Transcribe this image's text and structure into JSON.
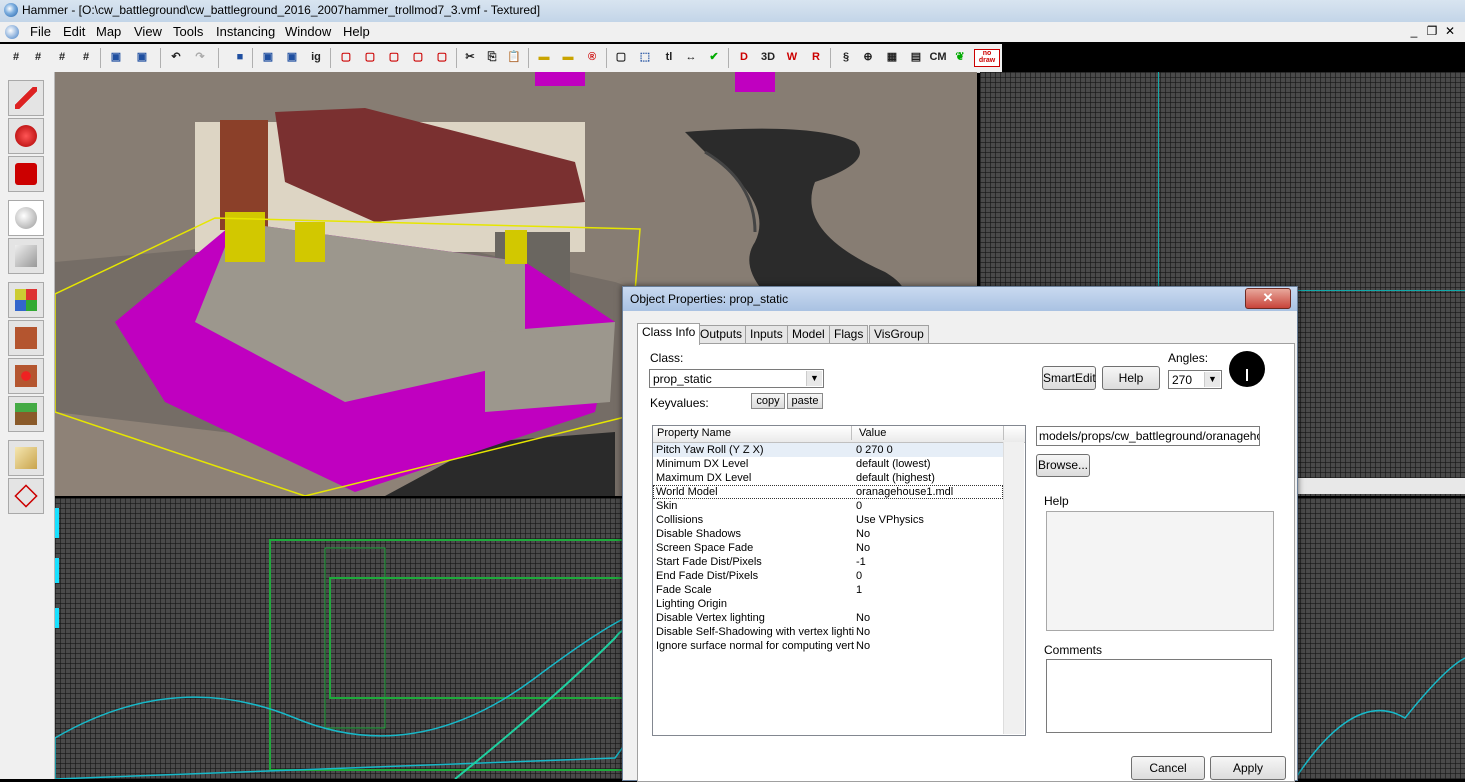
{
  "window": {
    "title": "Hammer - [O:\\cw_battleground\\cw_battleground_2016_2007hammer_trollmod7_3.vmf - Textured]"
  },
  "menu": [
    "File",
    "Edit",
    "Map",
    "View",
    "Tools",
    "Instancing",
    "Window",
    "Help"
  ],
  "toolbar": {
    "label_tl": "tl",
    "label_cm": "CM",
    "label_nodraw": "no draw"
  },
  "dialog": {
    "title": "Object Properties: prop_static",
    "close": "✕",
    "tabs": [
      "Class Info",
      "Outputs",
      "Inputs",
      "Model",
      "Flags",
      "VisGroup"
    ],
    "class_label": "Class:",
    "class_value": "prop_static",
    "keyvalues_label": "Keyvalues:",
    "copy": "copy",
    "paste": "paste",
    "smartedit": "SmartEdit",
    "help_btn": "Help",
    "angles_label": "Angles:",
    "angles_value": "270",
    "columns": [
      "Property Name",
      "Value"
    ],
    "rows": [
      {
        "k": "Pitch Yaw Roll (Y Z X)",
        "v": "0 270 0"
      },
      {
        "k": "Minimum DX Level",
        "v": "default (lowest)"
      },
      {
        "k": "Maximum DX Level",
        "v": "default (highest)"
      },
      {
        "k": "World Model",
        "v": "oranagehouse1.mdl"
      },
      {
        "k": "Skin",
        "v": "0"
      },
      {
        "k": "Collisions",
        "v": "Use VPhysics"
      },
      {
        "k": "Disable Shadows",
        "v": "No"
      },
      {
        "k": "Screen Space Fade",
        "v": "No"
      },
      {
        "k": "Start Fade Dist/Pixels",
        "v": "-1"
      },
      {
        "k": "End Fade Dist/Pixels",
        "v": "0"
      },
      {
        "k": "Fade Scale",
        "v": "1"
      },
      {
        "k": "Lighting Origin",
        "v": ""
      },
      {
        "k": "Disable Vertex lighting",
        "v": "No"
      },
      {
        "k": "Disable Self-Shadowing with vertex lighting",
        "v": "No"
      },
      {
        "k": "Ignore surface normal for computing vertex lighting",
        "v": "No"
      }
    ],
    "model_path": "models/props/cw_battleground/oranagehouse",
    "browse": "Browse...",
    "help_label": "Help",
    "comments_label": "Comments",
    "cancel": "Cancel",
    "apply": "Apply"
  }
}
